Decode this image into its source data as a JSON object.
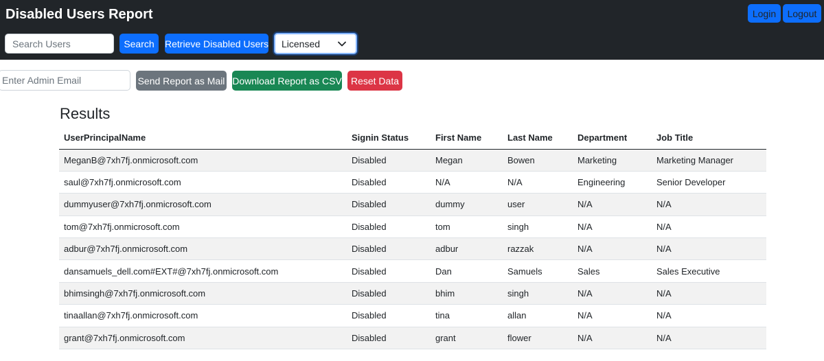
{
  "app": {
    "title": "Disabled Users Report"
  },
  "nav": {
    "login_label": "Login",
    "logout_label": "Logout"
  },
  "search": {
    "placeholder": "Search Users",
    "value": "",
    "button_label": "Search",
    "retrieve_label": "Retrieve Disabled Users",
    "license_filter": "Licensed"
  },
  "report": {
    "admin_email_placeholder": "Enter Admin Email",
    "send_label": "Send Report as Mail",
    "csv_label": "Download Report as CSV",
    "reset_label": "Reset Data"
  },
  "results": {
    "heading": "Results",
    "columns": [
      "UserPrincipalName",
      "Signin Status",
      "First Name",
      "Last Name",
      "Department",
      "Job Title"
    ],
    "rows": [
      [
        "MeganB@7xh7fj.onmicrosoft.com",
        "Disabled",
        "Megan",
        "Bowen",
        "Marketing",
        "Marketing Manager"
      ],
      [
        "saul@7xh7fj.onmicrosoft.com",
        "Disabled",
        "N/A",
        "N/A",
        "Engineering",
        "Senior Developer"
      ],
      [
        "dummyuser@7xh7fj.onmicrosoft.com",
        "Disabled",
        "dummy",
        "user",
        "N/A",
        "N/A"
      ],
      [
        "tom@7xh7fj.onmicrosoft.com",
        "Disabled",
        "tom",
        "singh",
        "N/A",
        "N/A"
      ],
      [
        "adbur@7xh7fj.onmicrosoft.com",
        "Disabled",
        "adbur",
        "razzak",
        "N/A",
        "N/A"
      ],
      [
        "dansamuels_dell.com#EXT#@7xh7fj.onmicrosoft.com",
        "Disabled",
        "Dan",
        "Samuels",
        "Sales",
        "Sales Executive"
      ],
      [
        "bhimsingh@7xh7fj.onmicrosoft.com",
        "Disabled",
        "bhim",
        "singh",
        "N/A",
        "N/A"
      ],
      [
        "tinaallan@7xh7fj.onmicrosoft.com",
        "Disabled",
        "tina",
        "allan",
        "N/A",
        "N/A"
      ],
      [
        "grant@7xh7fj.onmicrosoft.com",
        "Disabled",
        "grant",
        "flower",
        "N/A",
        "N/A"
      ]
    ]
  },
  "icons": {
    "select_chevron": "chevron-down-icon"
  },
  "colors": {
    "topbar": "#212529",
    "primary": "#0d6efd",
    "secondary": "#6c757d",
    "success": "#198754",
    "danger": "#dc3545",
    "row_stripe": "#f2f2f2"
  }
}
